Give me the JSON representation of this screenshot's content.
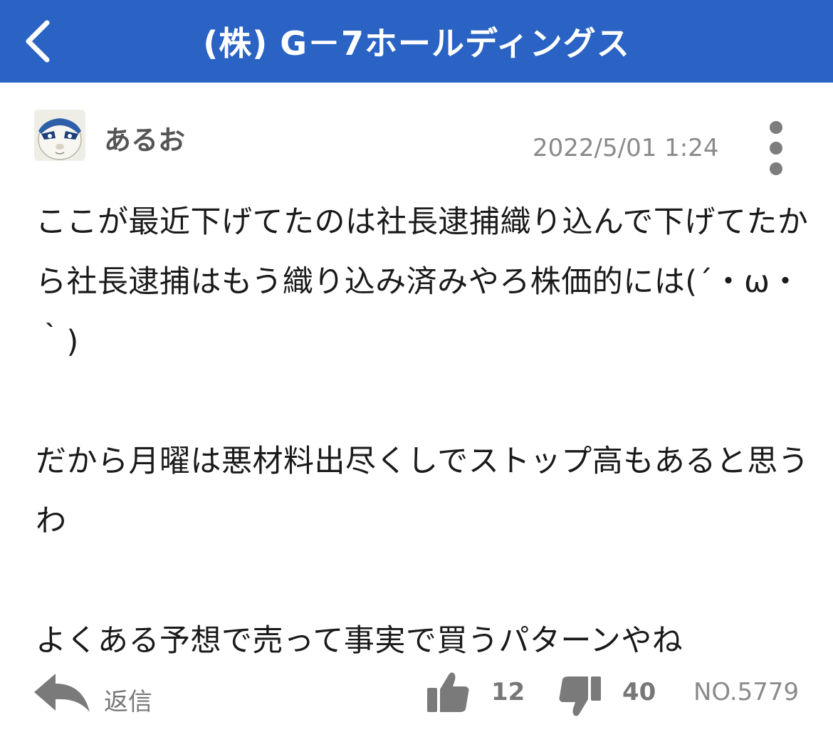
{
  "header": {
    "back_icon": "chevron-left-icon",
    "title": "(株) G－7ホールディングス",
    "background": "#2a63c3"
  },
  "post": {
    "username": "あるお",
    "timestamp": "2022/5/01 1:24",
    "more_icon": "vertical-ellipsis-icon",
    "paragraphs": [
      "ここが最近下げてたのは社長逮捕織り込んで下げてたから社長逮捕はもう織り込み済みやろ株価的には(´・ω・｀)",
      "だから月曜は悪材料出尽くしでストップ高もあると思うわ",
      "よくある予想で売って事実で買うパターンやね"
    ]
  },
  "footer": {
    "reply_icon": "reply-arrow-icon",
    "reply_label": "返信",
    "like_icon": "thumbs-up-icon",
    "like_count": "12",
    "dislike_icon": "thumbs-down-icon",
    "dislike_count": "40",
    "post_number": "NO.5779"
  }
}
